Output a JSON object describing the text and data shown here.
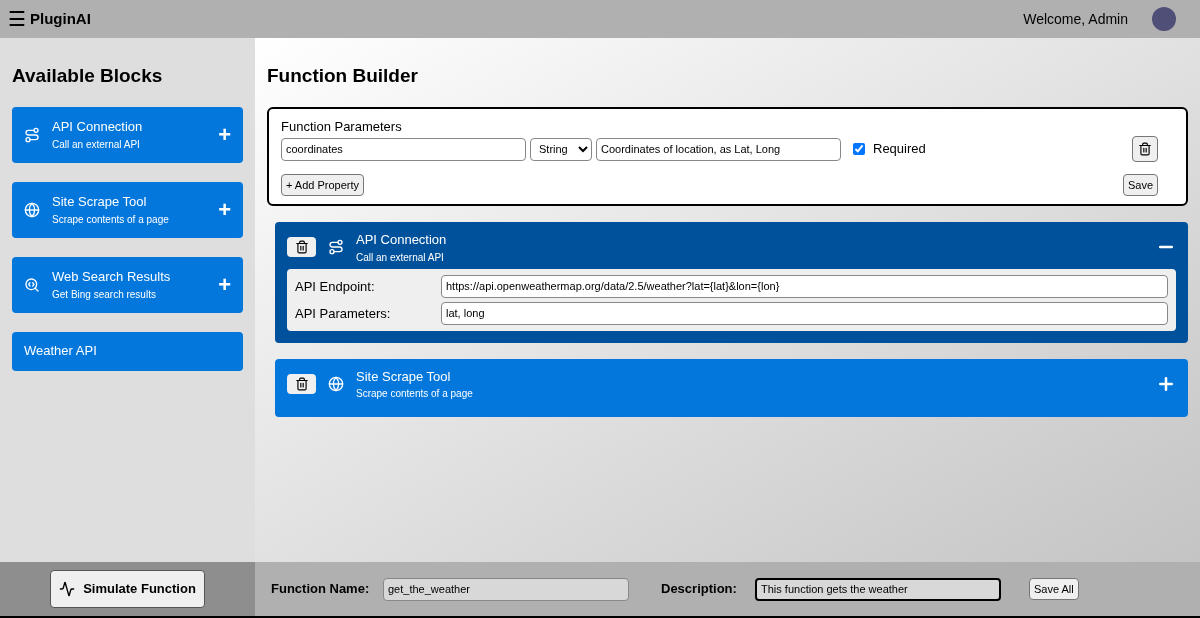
{
  "header": {
    "menu_icon": "☰",
    "app_name": "PluginAI",
    "welcome": "Welcome, Admin"
  },
  "sidebar": {
    "title": "Available Blocks",
    "blocks": [
      {
        "kind": "api",
        "title": "API Connection",
        "subtitle": "Call an external API",
        "add": "+"
      },
      {
        "kind": "scrape",
        "title": "Site Scrape Tool",
        "subtitle": "Scrape contents of a page",
        "add": "+"
      },
      {
        "kind": "search",
        "title": "Web Search Results",
        "subtitle": "Get Bing search results",
        "add": "+"
      },
      {
        "kind": "custom",
        "title": "Weather API"
      }
    ]
  },
  "builder": {
    "title": "Function Builder",
    "parameters": {
      "label": "Function Parameters",
      "rows": [
        {
          "name": "coordinates",
          "type": "String",
          "description": "Coordinates of location, as Lat, Long",
          "required_label": "Required",
          "required": true
        }
      ],
      "add_button": "+ Add Property",
      "save_button": "Save"
    },
    "blocks": [
      {
        "kind": "api",
        "title": "API Connection",
        "subtitle": "Call an external API",
        "expanded": true,
        "fields": [
          {
            "label": "API Endpoint:",
            "value": "https://api.openweathermap.org/data/2.5/weather?lat={lat}&lon={lon}"
          },
          {
            "label": "API Parameters:",
            "value": "lat, long"
          }
        ]
      },
      {
        "kind": "scrape",
        "title": "Site Scrape Tool",
        "subtitle": "Scrape contents of a page",
        "expanded": false
      }
    ]
  },
  "footer": {
    "simulate_button": "Simulate Function",
    "name_label": "Function Name:",
    "name_value": "get_the_weather",
    "description_label": "Description:",
    "description_value": "This function gets the weather",
    "save_all": "Save All"
  }
}
